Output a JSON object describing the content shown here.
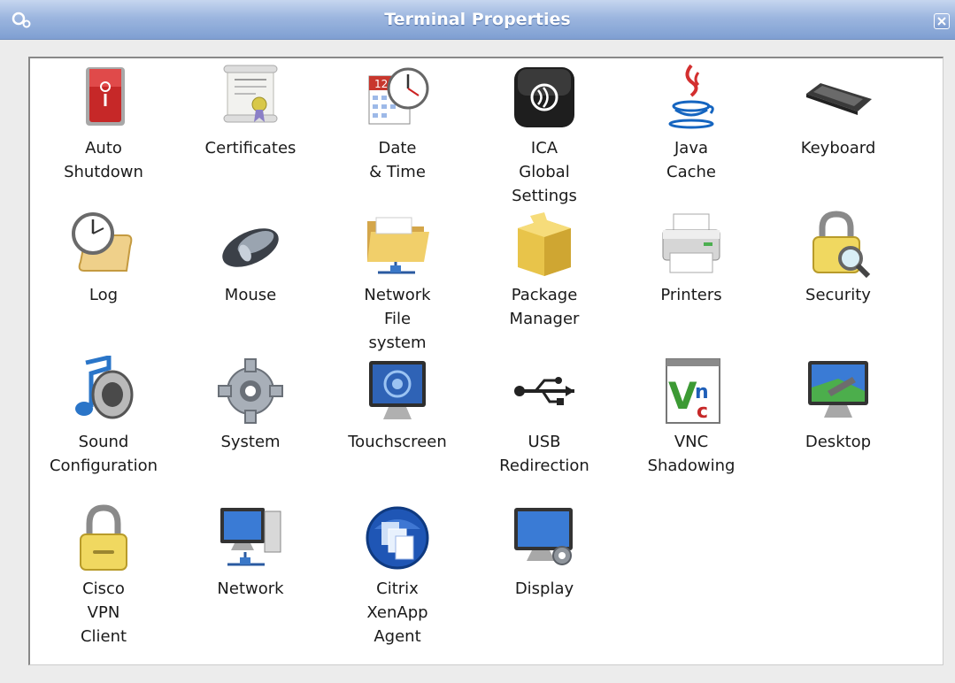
{
  "window": {
    "title": "Terminal Properties",
    "icon": "gears-icon",
    "close_icon": "close-icon"
  },
  "items": [
    {
      "label": "Auto\nShutdown",
      "icon": "power-switch-icon"
    },
    {
      "label": "Certificates",
      "icon": "certificate-scroll-icon"
    },
    {
      "label": "Date\n& Time",
      "icon": "calendar-clock-icon"
    },
    {
      "label": "ICA\nGlobal\nSettings",
      "icon": "ica-signal-icon"
    },
    {
      "label": "Java\nCache",
      "icon": "java-cup-icon"
    },
    {
      "label": "Keyboard",
      "icon": "keyboard-icon"
    },
    {
      "label": "Log",
      "icon": "log-scroll-clock-icon"
    },
    {
      "label": "Mouse",
      "icon": "mouse-icon"
    },
    {
      "label": "Network\nFile\nsystem",
      "icon": "network-folder-icon"
    },
    {
      "label": "Package\nManager",
      "icon": "package-box-icon"
    },
    {
      "label": "Printers",
      "icon": "printer-icon"
    },
    {
      "label": "Security",
      "icon": "padlock-magnifier-icon"
    },
    {
      "label": "Sound\nConfiguration",
      "icon": "music-speaker-icon"
    },
    {
      "label": "System",
      "icon": "gear-icon"
    },
    {
      "label": "Touchscreen",
      "icon": "touchscreen-monitor-icon"
    },
    {
      "label": "USB\nRedirection",
      "icon": "usb-icon"
    },
    {
      "label": "VNC\nShadowing",
      "icon": "vnc-icon"
    },
    {
      "label": "Desktop",
      "icon": "desktop-monitor-icon"
    },
    {
      "label": "Cisco\nVPN\nClient",
      "icon": "vpn-padlock-icon"
    },
    {
      "label": "Network",
      "icon": "network-computer-icon"
    },
    {
      "label": "Citrix\nXenApp\nAgent",
      "icon": "citrix-xenapp-icon"
    },
    {
      "label": "Display",
      "icon": "display-settings-icon"
    }
  ]
}
